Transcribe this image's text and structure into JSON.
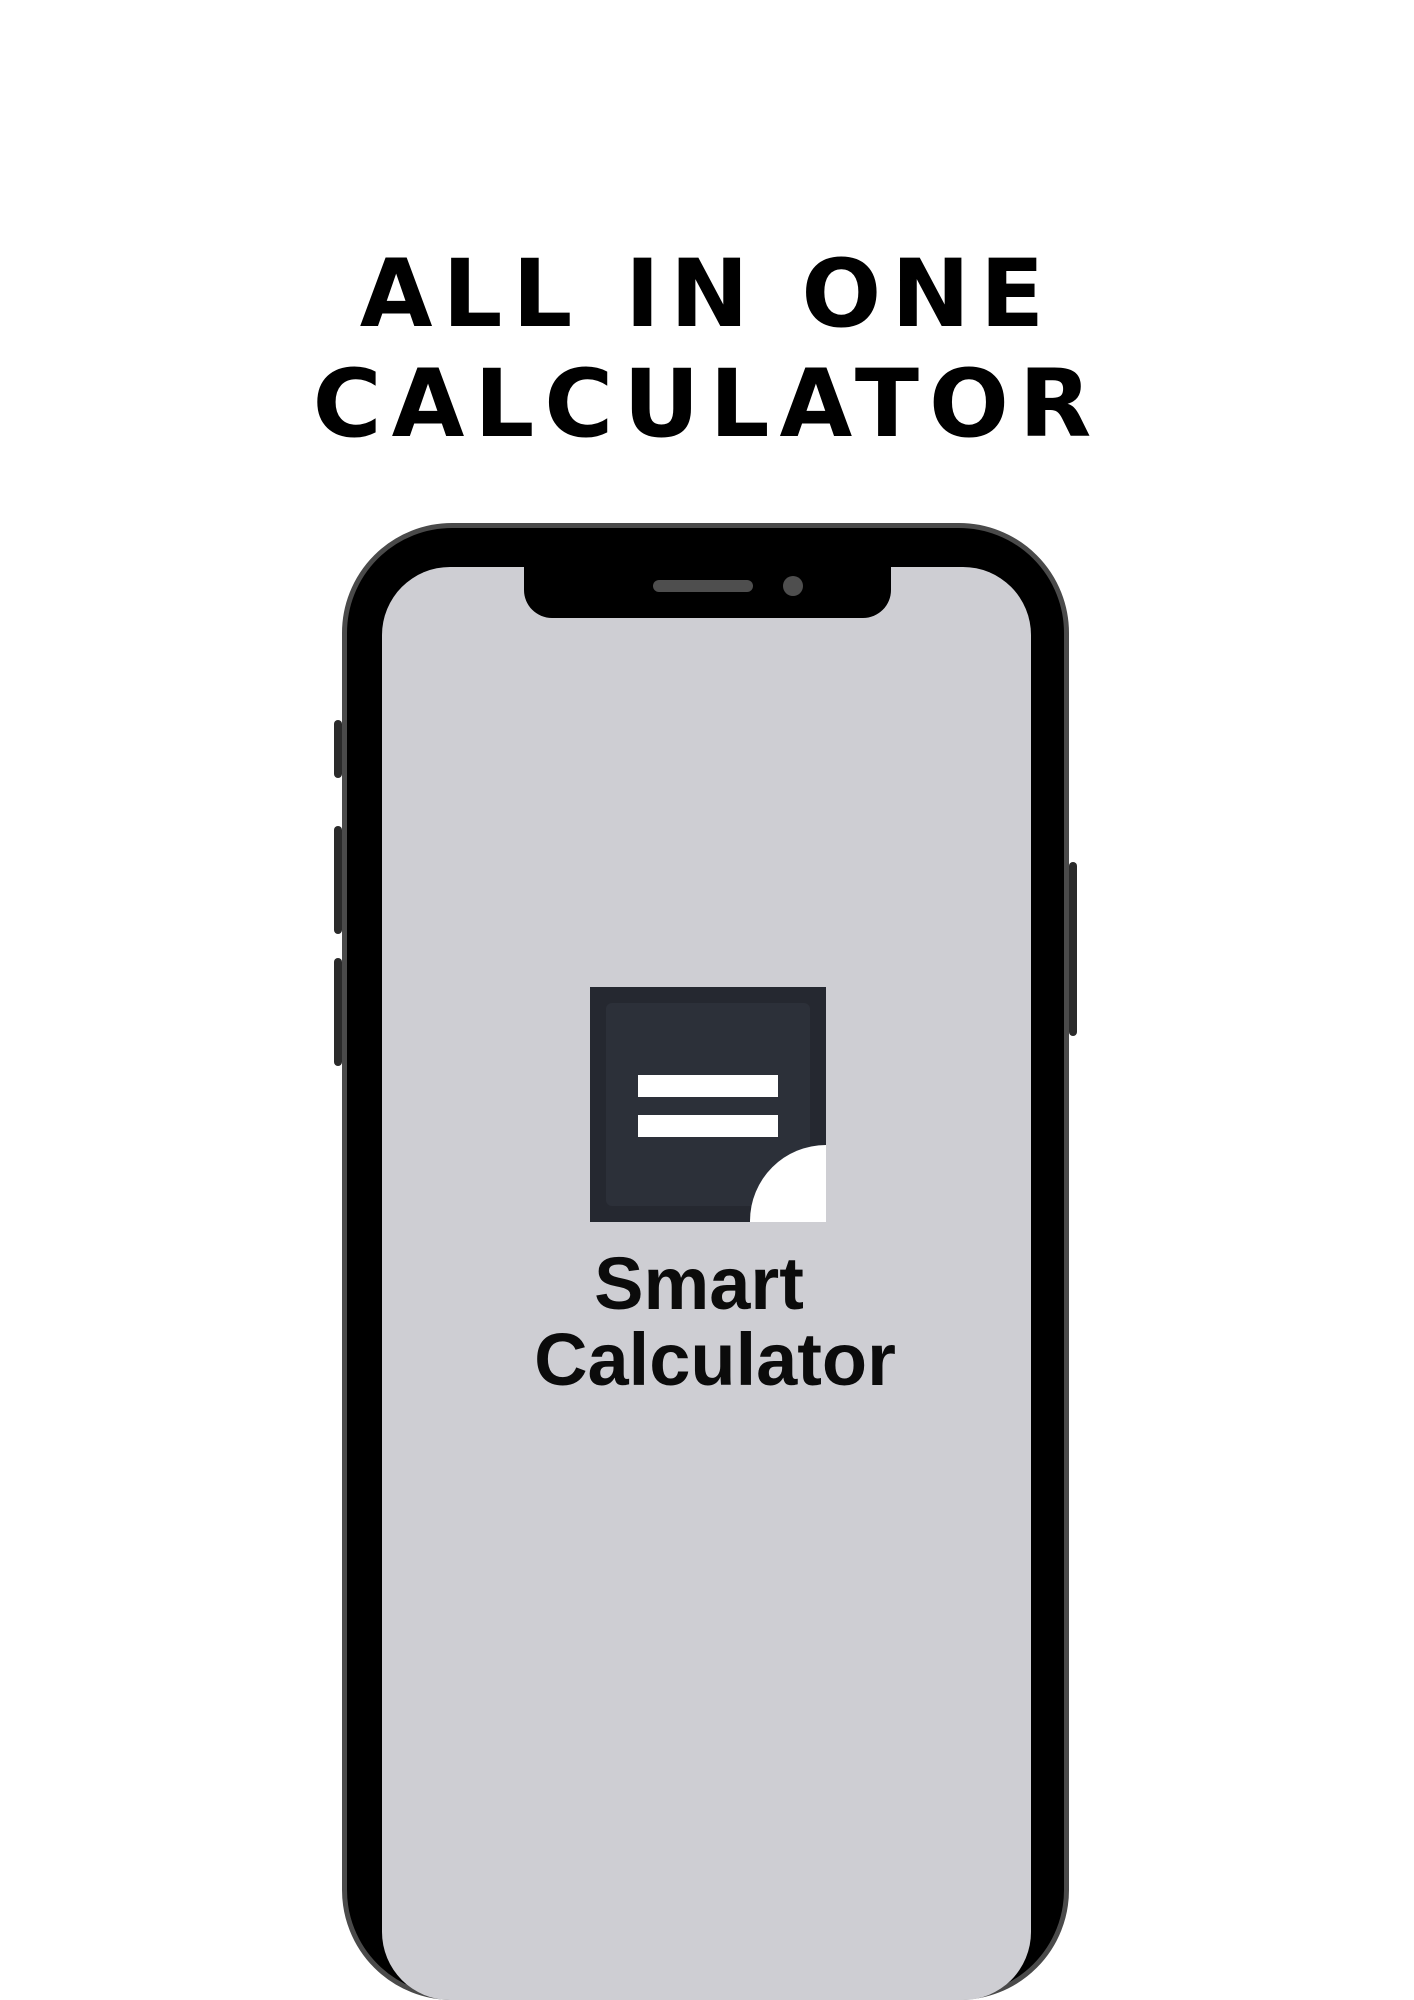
{
  "headline": "ALL IN ONE CALCULATOR",
  "app": {
    "name_line1": "Smart",
    "name_line2": "Calculator",
    "icon": "calculator-equals-icon"
  },
  "colors": {
    "background": "#ffffff",
    "phone_frame": "#000000",
    "screen": "#ceced3",
    "icon_bg": "#252830",
    "text": "#0b0b0b"
  }
}
